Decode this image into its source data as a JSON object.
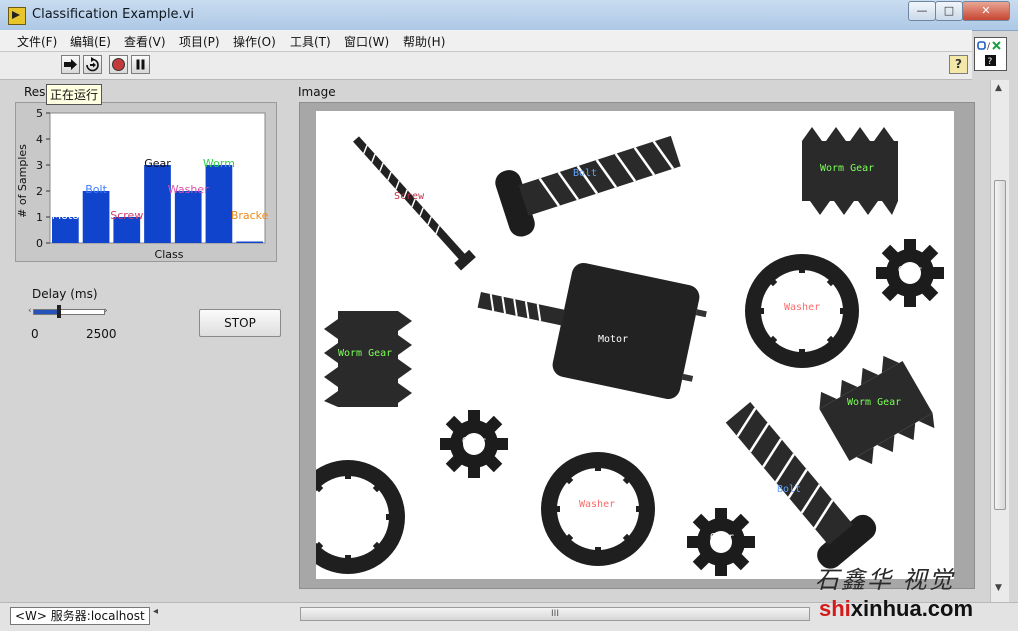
{
  "window": {
    "title": "Classification Example.vi",
    "minimize": "—",
    "maximize": "□",
    "close": "✕"
  },
  "menu": [
    "文件(F)",
    "编辑(E)",
    "查看(V)",
    "项目(P)",
    "操作(O)",
    "工具(T)",
    "窗口(W)",
    "帮助(H)"
  ],
  "toolbar": {
    "help": "?",
    "tooltip": "正在运行"
  },
  "chart_data": {
    "type": "bar",
    "title": "Res",
    "xlabel": "Class",
    "ylabel": "# of Samples",
    "categories": [
      "Motor",
      "Bolt",
      "Screw",
      "Gear",
      "Washer",
      "Worm",
      "Bracket"
    ],
    "category_labels": [
      "Moto",
      "Bolt",
      "Screw",
      "Gear",
      "Washer",
      "Worm",
      "Bracke"
    ],
    "values": [
      1,
      2,
      1,
      3,
      2,
      3,
      0
    ],
    "label_colors": [
      "#ffffff",
      "#3b7cff",
      "#d23c6e",
      "#111111",
      "#e04fa8",
      "#2fd04a",
      "#f08a1c"
    ],
    "bar_color": "#1144cc",
    "ylim": [
      0,
      5
    ],
    "yticks": [
      "0",
      "1",
      "2",
      "3",
      "4",
      "5"
    ]
  },
  "delay": {
    "label": "Delay (ms)",
    "min": "0",
    "max": "2500",
    "value_fraction": 0.35
  },
  "stop_label": "STOP",
  "image": {
    "label": "Image",
    "annotations": {
      "screw": "Screw",
      "bolt_top": "Bolt",
      "worm_top_right": "Worm Gear",
      "worm_left": "Worm Gear",
      "motor": "Motor",
      "washer_right": "Washer",
      "gear_right": "Gear",
      "worm_right": "Worm Gear",
      "gear_mid": "Gear",
      "washer_bottom": "Washer",
      "bolt_bottom": "Bolt",
      "gear_bottom": "Gear"
    }
  },
  "status": {
    "server": "<W> 服务器:localhost",
    "scroll_grip": "III"
  },
  "watermark": {
    "chinese": "石鑫华 视觉",
    "url_accent": "shi",
    "url_rest": "xinhua.com"
  }
}
